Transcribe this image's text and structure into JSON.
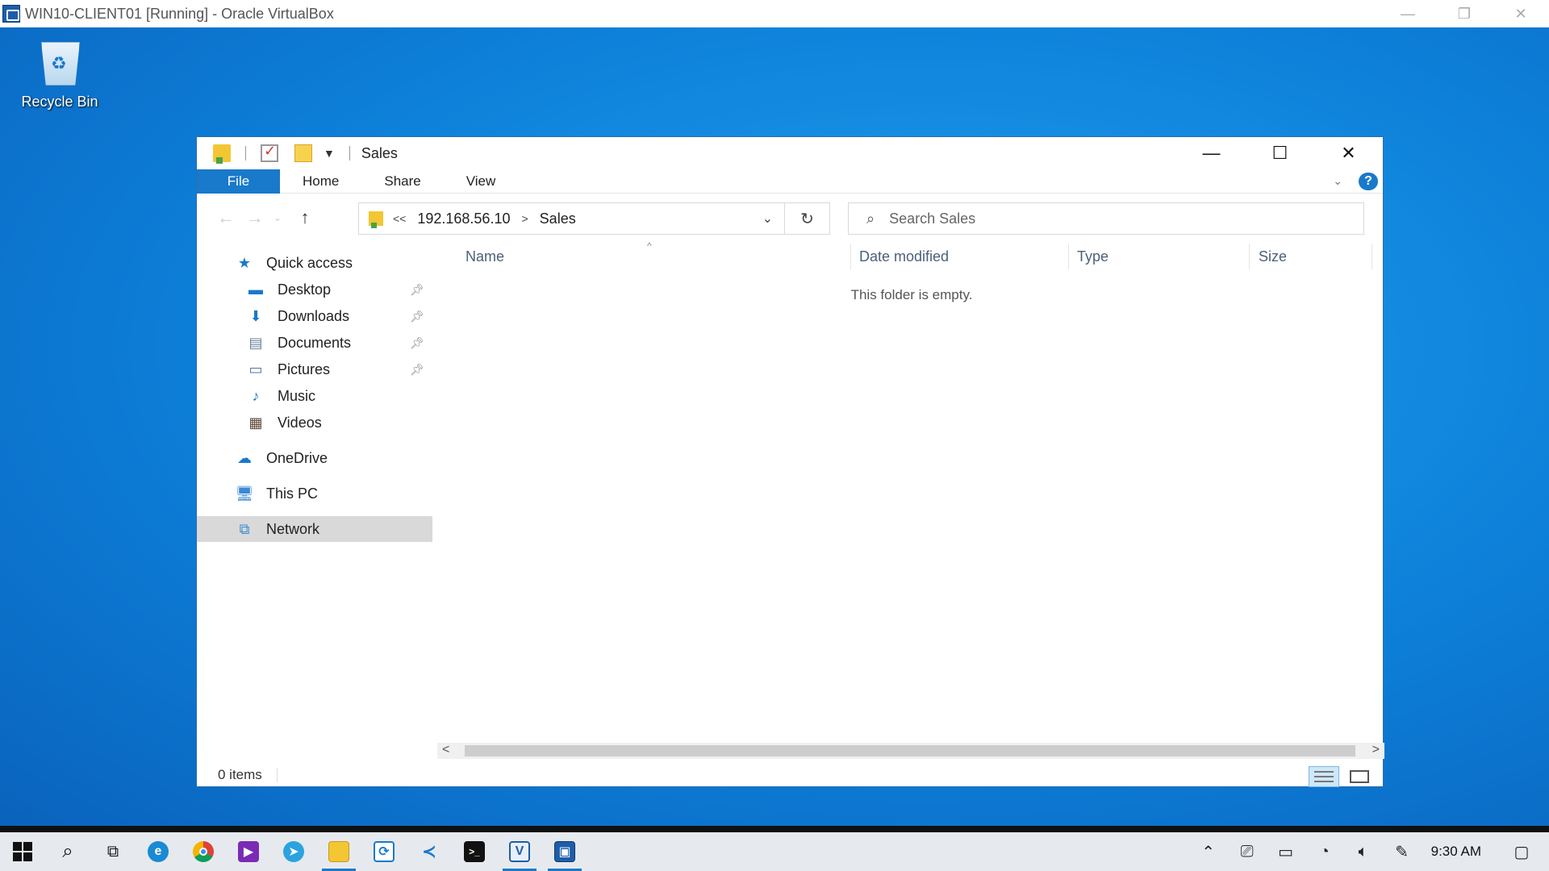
{
  "host": {
    "title": "WIN10-CLIENT01 [Running] - Oracle VirtualBox",
    "controls": [
      "—",
      "❐",
      "✕"
    ]
  },
  "desktop": {
    "icons": [
      {
        "label": "Recycle Bin",
        "icon": "recycle-bin-icon"
      }
    ]
  },
  "explorer": {
    "title": "Sales",
    "tabs": [
      "File",
      "Home",
      "Share",
      "View"
    ],
    "address": {
      "overflow": "<<",
      "crumbs": [
        "192.168.56.10",
        "Sales"
      ],
      "separator": ">"
    },
    "search_placeholder": "Search Sales",
    "sidebar": {
      "quick_access": "Quick access",
      "quick_items": [
        {
          "label": "Desktop",
          "icon": "desktop-icon",
          "pinned": true
        },
        {
          "label": "Downloads",
          "icon": "downloads-icon",
          "pinned": true
        },
        {
          "label": "Documents",
          "icon": "documents-icon",
          "pinned": true
        },
        {
          "label": "Pictures",
          "icon": "pictures-icon",
          "pinned": true
        },
        {
          "label": "Music",
          "icon": "music-icon",
          "pinned": false
        },
        {
          "label": "Videos",
          "icon": "videos-icon",
          "pinned": false
        }
      ],
      "onedrive": "OneDrive",
      "this_pc": "This PC",
      "network": "Network",
      "selected": "Network"
    },
    "columns": [
      "Name",
      "Date modified",
      "Type",
      "Size"
    ],
    "empty_message": "This folder is empty.",
    "status": "0 items",
    "help_label": "?"
  },
  "taskbar": {
    "apps": [
      {
        "name": "start",
        "icon": "windows-logo-icon"
      },
      {
        "name": "search",
        "icon": "search-icon"
      },
      {
        "name": "task-view",
        "icon": "task-view-icon"
      },
      {
        "name": "edge",
        "icon": "edge-icon"
      },
      {
        "name": "chrome",
        "icon": "chrome-icon"
      },
      {
        "name": "media",
        "icon": "media-icon"
      },
      {
        "name": "telegram",
        "icon": "telegram-icon"
      },
      {
        "name": "file-explorer",
        "icon": "folder-icon",
        "active": true
      },
      {
        "name": "app",
        "icon": "app-icon"
      },
      {
        "name": "vscode",
        "icon": "vscode-icon"
      },
      {
        "name": "terminal",
        "icon": "terminal-icon"
      },
      {
        "name": "virtualbox-manager",
        "icon": "virtualbox-icon",
        "active": true
      },
      {
        "name": "virtualbox-vm",
        "icon": "virtualbox-vm-icon",
        "active": true
      }
    ],
    "clock": "9:30 AM"
  },
  "colors": {
    "accent": "#1979ca",
    "desktop": "#0d7fd8",
    "selected": "#d9d9d9"
  }
}
